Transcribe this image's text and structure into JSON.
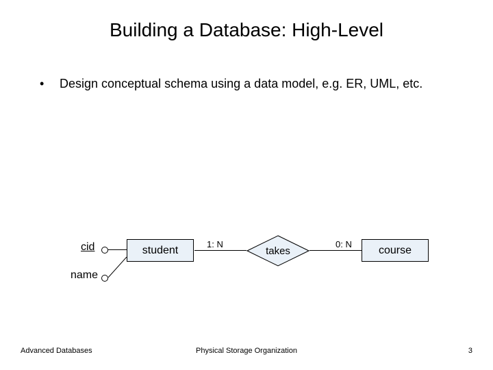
{
  "title": "Building a Database: High-Level",
  "bullet": "Design conceptual schema using a data model, e.g. ER, UML, etc.",
  "er": {
    "attributes": {
      "cid": "cid",
      "name": "name"
    },
    "entities": {
      "student": "student",
      "course": "course"
    },
    "relationship": "takes",
    "cardinality": {
      "left": "1: N",
      "right": "0: N"
    }
  },
  "footer": {
    "left": "Advanced Databases",
    "center": "Physical Storage Organization",
    "pageNumber": "3"
  }
}
